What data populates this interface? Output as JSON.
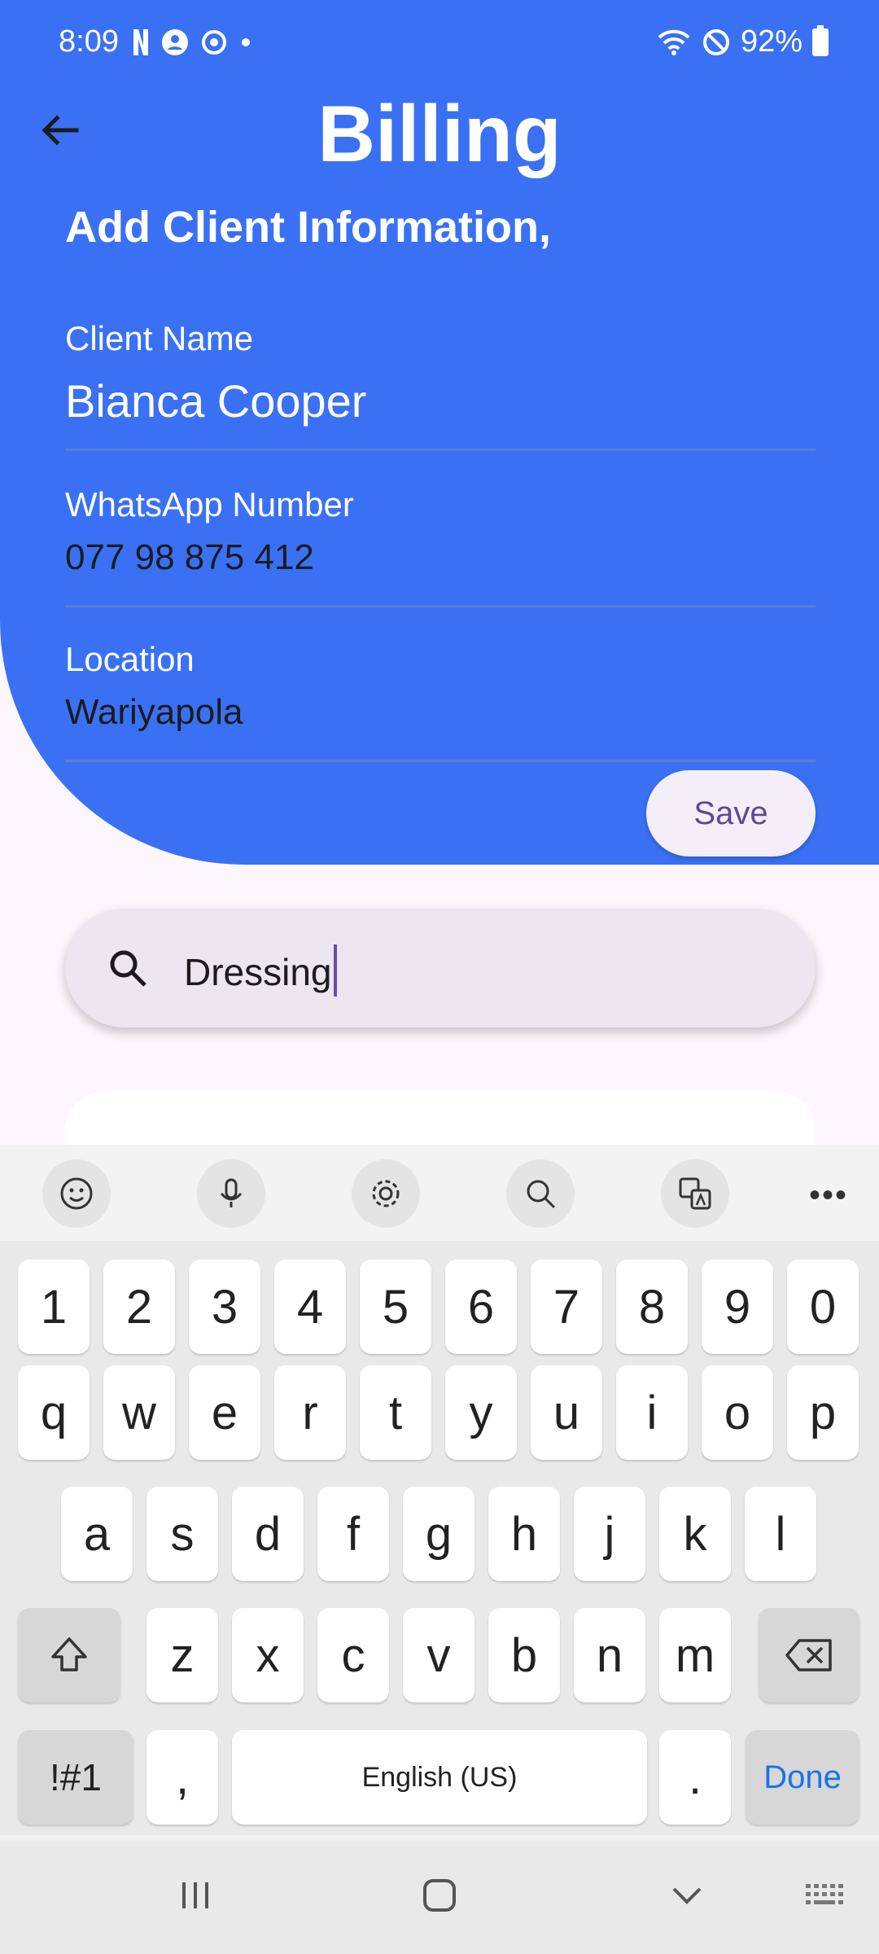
{
  "status_bar": {
    "time": "8:09",
    "battery": "92%",
    "icons": [
      "netflix-icon",
      "account-icon",
      "sync-icon",
      "dot-icon",
      "wifi-icon",
      "dnd-icon",
      "battery-icon"
    ]
  },
  "header": {
    "title": "Billing",
    "subtitle": "Add Client Information,"
  },
  "form": {
    "client_name_label": "Client Name",
    "client_name_value": "Bianca Cooper",
    "whatsapp_label": "WhatsApp Number",
    "whatsapp_value": "077 98 875 412",
    "location_label": "Location",
    "location_value": "Wariyapola",
    "save_label": "Save"
  },
  "search": {
    "value": "Dressing"
  },
  "keyboard": {
    "row_numbers": [
      "1",
      "2",
      "3",
      "4",
      "5",
      "6",
      "7",
      "8",
      "9",
      "0"
    ],
    "row_top": [
      "q",
      "w",
      "e",
      "r",
      "t",
      "y",
      "u",
      "i",
      "o",
      "p"
    ],
    "row_mid": [
      "a",
      "s",
      "d",
      "f",
      "g",
      "h",
      "j",
      "k",
      "l"
    ],
    "row_bottom": [
      "z",
      "x",
      "c",
      "v",
      "b",
      "n",
      "m"
    ],
    "symbols_label": "!#1",
    "comma_label": ",",
    "space_label": "English (US)",
    "period_label": ".",
    "done_label": "Done",
    "more_label": "•••"
  },
  "colors": {
    "header_blue": "#3a71f4",
    "save_text": "#5b4a98",
    "done_text": "#1a73e8"
  }
}
